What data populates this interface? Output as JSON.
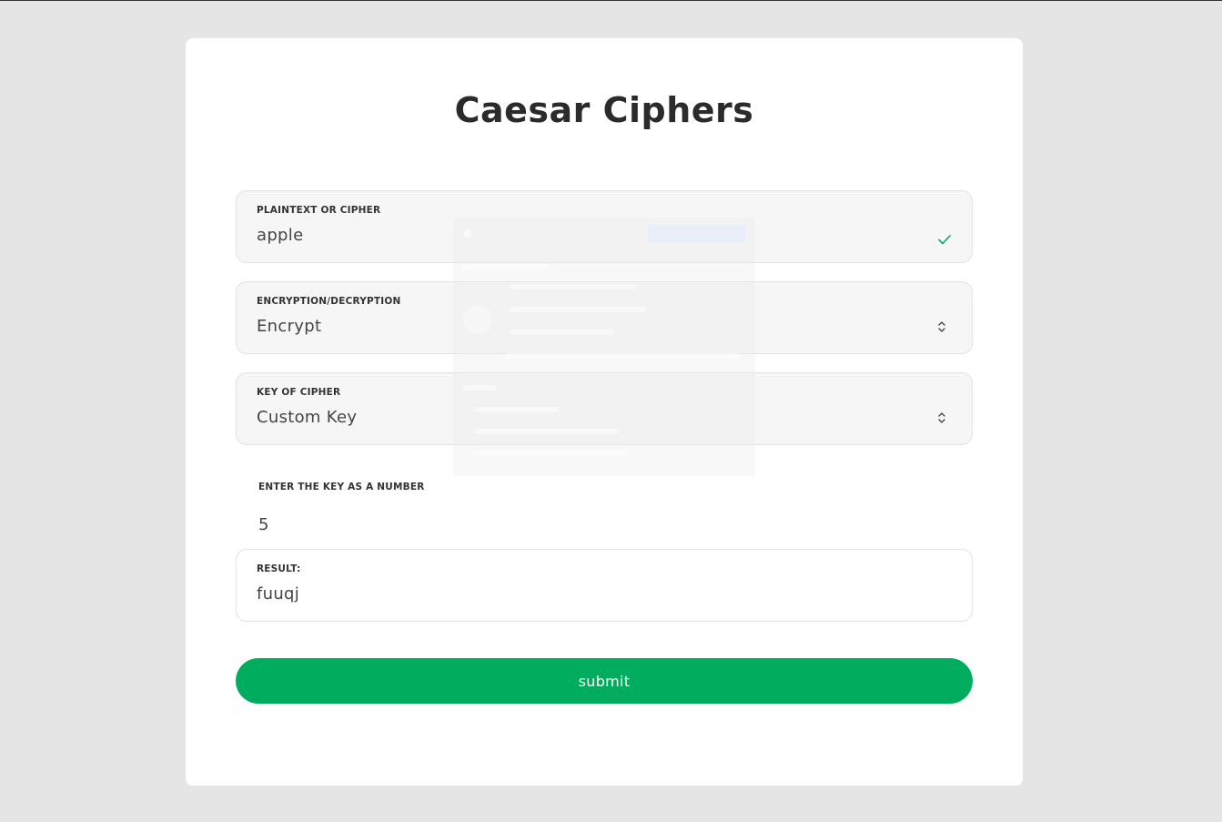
{
  "page": {
    "title": "Caesar Ciphers"
  },
  "form": {
    "plaintext": {
      "label": "PLAINTEXT OR CIPHER",
      "value": "apple"
    },
    "mode": {
      "label": "ENCRYPTION/DECRYPTION",
      "value": "Encrypt"
    },
    "key_type": {
      "label": "KEY OF CIPHER",
      "value": "Custom Key"
    },
    "key_number": {
      "label": "ENTER THE KEY AS A NUMBER",
      "value": "5"
    },
    "result": {
      "label": "RESULT:",
      "value": "fuuqj"
    },
    "submit_label": "submit"
  },
  "colors": {
    "accent": "#00ad5f",
    "background": "#e5e5e5",
    "card": "#ffffff",
    "valid_check": "#00ad5f"
  },
  "icons": {
    "valid": "check-icon",
    "select": "chevron-updown-icon"
  }
}
